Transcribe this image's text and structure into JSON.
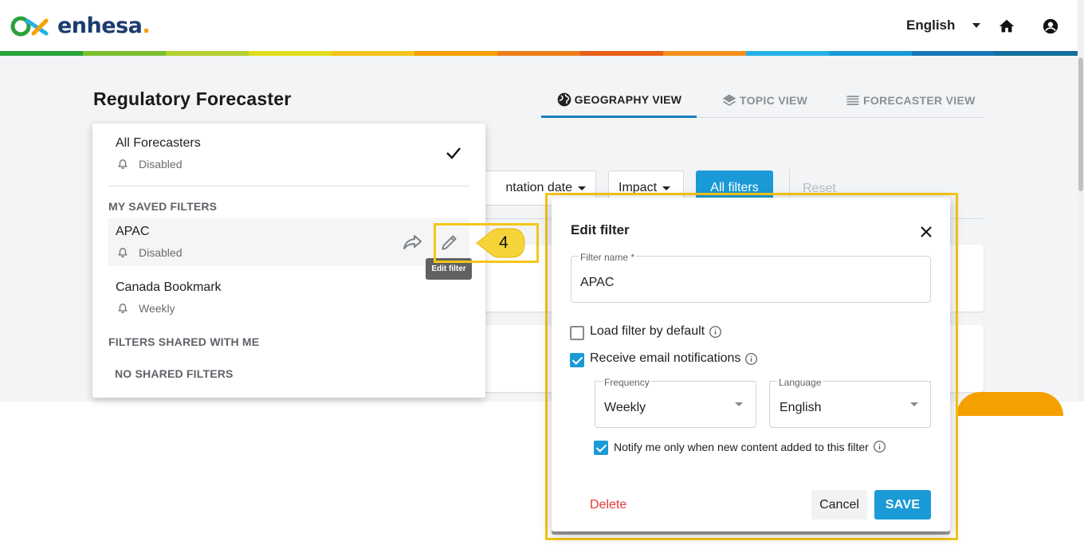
{
  "header": {
    "logo_text": "enhesa",
    "logo_dot": ".",
    "language": "English"
  },
  "brand_colors": [
    "#2aa23a",
    "#7cbf2f",
    "#b4d130",
    "#e3dc1a",
    "#f5c518",
    "#f5a000",
    "#ee7d1a",
    "#e55f17",
    "#f38f1b",
    "#27b0e6",
    "#1a9ad6",
    "#1876b6",
    "#136f9b"
  ],
  "page": {
    "title": "Regulatory Forecaster"
  },
  "tabs": [
    {
      "label": "GEOGRAPHY VIEW",
      "icon": "globe-icon",
      "active": true
    },
    {
      "label": "TOPIC VIEW",
      "icon": "layers-icon",
      "active": false
    },
    {
      "label": "FORECASTER VIEW",
      "icon": "list-icon",
      "active": false
    }
  ],
  "filter_bar": {
    "implementation_date": "ntation date",
    "impact": "Impact",
    "all_filters": "All filters",
    "reset": "Reset"
  },
  "dropdown": {
    "all_forecasters": {
      "title": "All Forecasters",
      "status": "Disabled"
    },
    "my_saved_filters_heading": "MY SAVED FILTERS",
    "saved_filters": [
      {
        "title": "APAC",
        "status": "Disabled"
      },
      {
        "title": "Canada Bookmark",
        "status": "Weekly"
      }
    ],
    "shared_heading": "FILTERS SHARED WITH ME",
    "no_shared": "NO SHARED FILTERS",
    "tooltip": "Edit filter"
  },
  "callout": {
    "number": "4"
  },
  "dialog": {
    "title": "Edit filter",
    "filter_name_label": "Filter name *",
    "filter_name_value": "APAC",
    "load_default_label": "Load filter by default",
    "load_default_checked": false,
    "email_label": "Receive email notifications",
    "email_checked": true,
    "frequency_label": "Frequency",
    "frequency_value": "Weekly",
    "language_label": "Language",
    "language_value": "English",
    "notify_label": "Notify me only when new content added to this filter",
    "notify_checked": true,
    "delete_label": "Delete",
    "cancel_label": "Cancel",
    "save_label": "SAVE"
  }
}
